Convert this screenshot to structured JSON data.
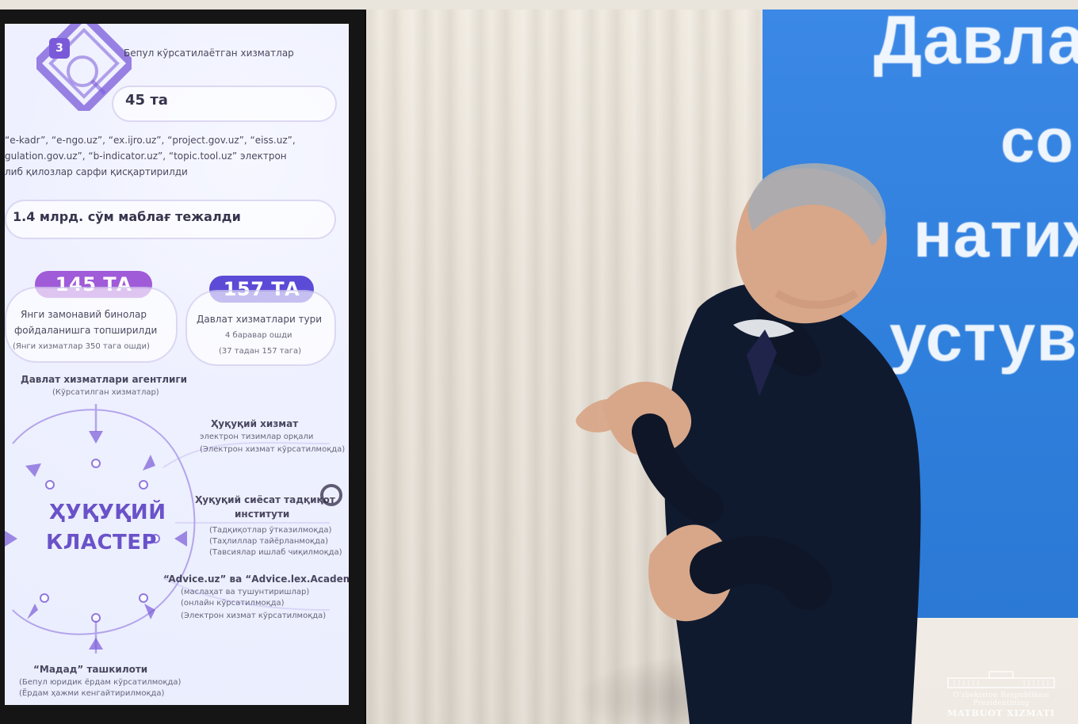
{
  "screen": {
    "header_number": "3",
    "header_title": "Бепул кўрсатилаётган хизматлар",
    "count_45": "45 та",
    "sites_line1": "“e-kadr”, “e-ngo.uz”, “ex.ijro.uz”, “project.gov.uz”, “eiss.uz”,",
    "sites_line2": "gulation.gov.uz”, “b-indicator.uz”, “topic.tool.uz” электрон",
    "sites_line3": "либ қилозлар сарфи қисқартирилди",
    "savings": "1.4 млрд. сўм маблағ тежалди",
    "badge_145": "145 ТА",
    "badge_157": "157 ТА",
    "box_left_line1": "Янги замонавий бинолар",
    "box_left_line2": "фойдаланишга топширилди",
    "box_left_line3": "(Янги хизматлар 350 тага ошди)",
    "box_right_line1": "Давлат хизматлари тури",
    "box_right_line2": "4 баравар ошди",
    "box_right_line3": "(37 тадан 157 тага)",
    "agency_title": "Давлат хизматлари агентлиги",
    "agency_sub": "(Кўрсатилган хизматлар)",
    "legal_service_title": "Ҳуқуқий хизмат",
    "legal_service_sub": "электрон тизимлар орқали",
    "legal_service_sub2": "(Электрон хизмат кўрсатилмоқда)",
    "legal_policy_title": "Ҳуқуқий сиёсат тадқиқот",
    "legal_policy_title2": "институти",
    "legal_policy_sub1": "(Тадқиқотлар ўтказилмоқда)",
    "legal_policy_sub2": "(Таҳлиллар тайёрланмоқда)",
    "legal_policy_sub3": "(Тавсиялар ишлаб чиқилмоқда)",
    "advice_title": "“Advice.uz” ва “Advice.lex.Academy”",
    "advice_sub1": "(маслаҳат ва тушунтиришлар)",
    "advice_sub2": "(онлайн кўрсатилмоқда)",
    "advice_sub3": "(Электрон хизмат кўрсатилмоқда)",
    "madad_title": "“Мадад” ташкилоти",
    "madad_sub1": "(Бепул юридик ёрдам кўрсатилмоқда)",
    "madad_sub2": "(Ёрдам ҳажми кенгайтирилмоқда)",
    "cluster_line1": "ҲУҚУҚИЙ",
    "cluster_line2": "КЛАСТЕР",
    "colors": {
      "purple": "#a05bd8",
      "indigo": "#5b4bd6",
      "accent": "#6a52c9"
    }
  },
  "banner": {
    "line1": "Давла",
    "line2": "со",
    "line3": "натиж",
    "line4": "устув"
  },
  "watermark": {
    "line1": "O'zbekiston Respublikasi Prezidentining",
    "line2": "MATBUOT XIZMATI"
  }
}
